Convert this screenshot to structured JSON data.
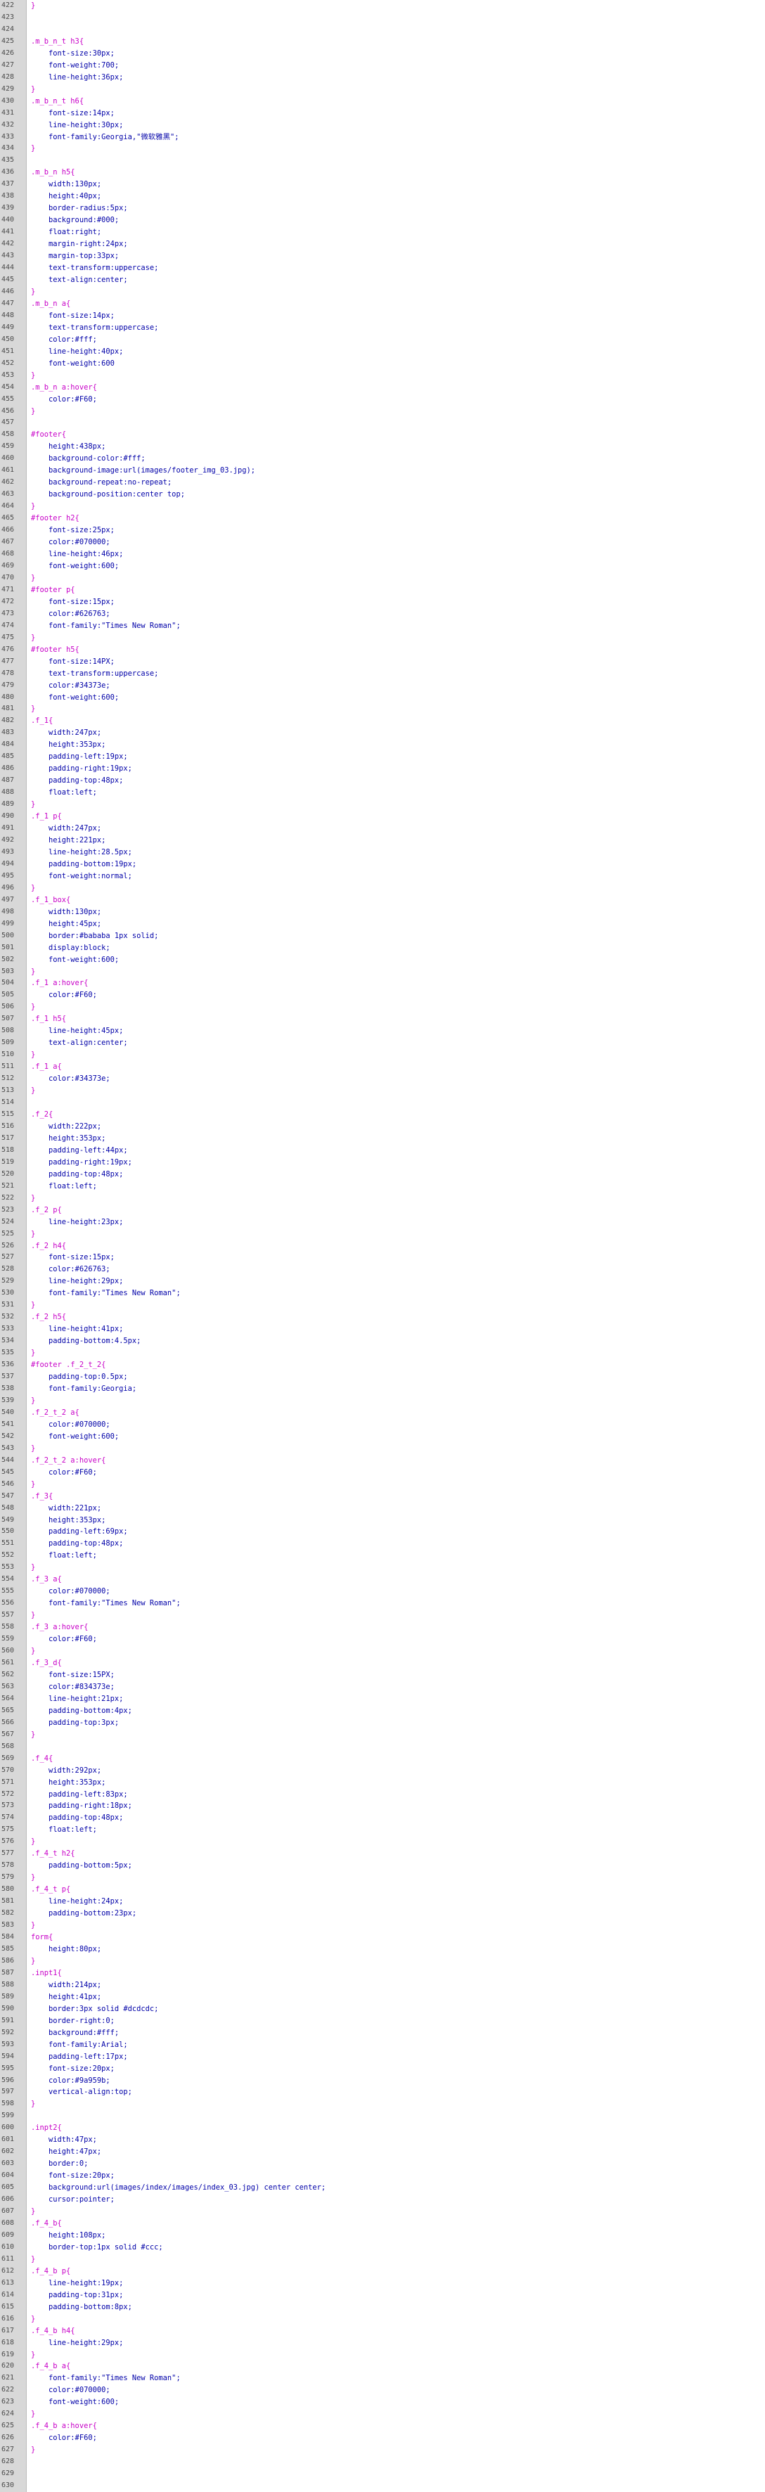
{
  "editor": {
    "colors": {
      "selector": "#c800c8",
      "brace": "#c800c8",
      "property": "#0000a8",
      "value": "#0000a8",
      "gutter_bg": "#d8d8d8",
      "line_number": "#4a4a4a"
    },
    "lines": [
      {
        "n": "422",
        "code": "}",
        "kind": "brace"
      },
      {
        "n": "423",
        "code": "",
        "kind": "blank"
      },
      {
        "n": "424",
        "code": "",
        "kind": "blank"
      },
      {
        "n": "425",
        "code": ".m_b_n_t h3{",
        "kind": "sel"
      },
      {
        "n": "426",
        "code": "    font-size:30px;",
        "kind": "decl"
      },
      {
        "n": "427",
        "code": "    font-weight:700;",
        "kind": "decl"
      },
      {
        "n": "428",
        "code": "    line-height:36px;",
        "kind": "decl"
      },
      {
        "n": "429",
        "code": "}",
        "kind": "brace"
      },
      {
        "n": "430",
        "code": ".m_b_n_t h6{",
        "kind": "sel"
      },
      {
        "n": "431",
        "code": "    font-size:14px;",
        "kind": "decl"
      },
      {
        "n": "432",
        "code": "    line-height:30px;",
        "kind": "decl"
      },
      {
        "n": "433",
        "code": "    font-family:Georgia,\"微软雅黑\";",
        "kind": "decl"
      },
      {
        "n": "434",
        "code": "}",
        "kind": "brace"
      },
      {
        "n": "435",
        "code": "",
        "kind": "blank"
      },
      {
        "n": "436",
        "code": ".m_b_n h5{",
        "kind": "sel"
      },
      {
        "n": "437",
        "code": "    width:130px;",
        "kind": "decl"
      },
      {
        "n": "438",
        "code": "    height:40px;",
        "kind": "decl"
      },
      {
        "n": "439",
        "code": "    border-radius:5px;",
        "kind": "decl"
      },
      {
        "n": "440",
        "code": "    background:#000;",
        "kind": "decl"
      },
      {
        "n": "441",
        "code": "    float:right;",
        "kind": "decl"
      },
      {
        "n": "442",
        "code": "    margin-right:24px;",
        "kind": "decl"
      },
      {
        "n": "443",
        "code": "    margin-top:33px;",
        "kind": "decl"
      },
      {
        "n": "444",
        "code": "    text-transform:uppercase;",
        "kind": "decl"
      },
      {
        "n": "445",
        "code": "    text-align:center;",
        "kind": "decl"
      },
      {
        "n": "446",
        "code": "}",
        "kind": "brace"
      },
      {
        "n": "447",
        "code": ".m_b_n a{",
        "kind": "sel"
      },
      {
        "n": "448",
        "code": "    font-size:14px;",
        "kind": "decl"
      },
      {
        "n": "449",
        "code": "    text-transform:uppercase;",
        "kind": "decl"
      },
      {
        "n": "450",
        "code": "    color:#fff;",
        "kind": "decl"
      },
      {
        "n": "451",
        "code": "    line-height:40px;",
        "kind": "decl"
      },
      {
        "n": "452",
        "code": "    font-weight:600",
        "kind": "decl"
      },
      {
        "n": "453",
        "code": "}",
        "kind": "brace"
      },
      {
        "n": "454",
        "code": ".m_b_n a:hover{",
        "kind": "sel"
      },
      {
        "n": "455",
        "code": "    color:#F60;",
        "kind": "decl"
      },
      {
        "n": "456",
        "code": "}",
        "kind": "brace"
      },
      {
        "n": "457",
        "code": "",
        "kind": "blank"
      },
      {
        "n": "458",
        "code": "#footer{",
        "kind": "sel"
      },
      {
        "n": "459",
        "code": "    height:438px;",
        "kind": "decl"
      },
      {
        "n": "460",
        "code": "    background-color:#fff;",
        "kind": "decl"
      },
      {
        "n": "461",
        "code": "    background-image:url(images/footer_img_03.jpg);",
        "kind": "decl"
      },
      {
        "n": "462",
        "code": "    background-repeat:no-repeat;",
        "kind": "decl"
      },
      {
        "n": "463",
        "code": "    background-position:center top;",
        "kind": "decl"
      },
      {
        "n": "464",
        "code": "}",
        "kind": "brace"
      },
      {
        "n": "465",
        "code": "#footer h2{",
        "kind": "sel"
      },
      {
        "n": "466",
        "code": "    font-size:25px;",
        "kind": "decl"
      },
      {
        "n": "467",
        "code": "    color:#070000;",
        "kind": "decl"
      },
      {
        "n": "468",
        "code": "    line-height:46px;",
        "kind": "decl"
      },
      {
        "n": "469",
        "code": "    font-weight:600;",
        "kind": "decl"
      },
      {
        "n": "470",
        "code": "}",
        "kind": "brace"
      },
      {
        "n": "471",
        "code": "#footer p{",
        "kind": "sel"
      },
      {
        "n": "472",
        "code": "    font-size:15px;",
        "kind": "decl"
      },
      {
        "n": "473",
        "code": "    color:#626763;",
        "kind": "decl"
      },
      {
        "n": "474",
        "code": "    font-family:\"Times New Roman\";",
        "kind": "decl"
      },
      {
        "n": "475",
        "code": "}",
        "kind": "brace"
      },
      {
        "n": "476",
        "code": "#footer h5{",
        "kind": "sel"
      },
      {
        "n": "477",
        "code": "    font-size:14PX;",
        "kind": "decl"
      },
      {
        "n": "478",
        "code": "    text-transform:uppercase;",
        "kind": "decl"
      },
      {
        "n": "479",
        "code": "    color:#34373e;",
        "kind": "decl"
      },
      {
        "n": "480",
        "code": "    font-weight:600;",
        "kind": "decl"
      },
      {
        "n": "481",
        "code": "}",
        "kind": "brace"
      },
      {
        "n": "482",
        "code": ".f_1{",
        "kind": "sel"
      },
      {
        "n": "483",
        "code": "    width:247px;",
        "kind": "decl"
      },
      {
        "n": "484",
        "code": "    height:353px;",
        "kind": "decl"
      },
      {
        "n": "485",
        "code": "    padding-left:19px;",
        "kind": "decl"
      },
      {
        "n": "486",
        "code": "    padding-right:19px;",
        "kind": "decl"
      },
      {
        "n": "487",
        "code": "    padding-top:48px;",
        "kind": "decl"
      },
      {
        "n": "488",
        "code": "    float:left;",
        "kind": "decl"
      },
      {
        "n": "489",
        "code": "}",
        "kind": "brace"
      },
      {
        "n": "490",
        "code": ".f_1 p{",
        "kind": "sel"
      },
      {
        "n": "491",
        "code": "    width:247px;",
        "kind": "decl"
      },
      {
        "n": "492",
        "code": "    height:221px;",
        "kind": "decl"
      },
      {
        "n": "493",
        "code": "    line-height:28.5px;",
        "kind": "decl"
      },
      {
        "n": "494",
        "code": "    padding-bottom:19px;",
        "kind": "decl"
      },
      {
        "n": "495",
        "code": "    font-weight:normal;",
        "kind": "decl"
      },
      {
        "n": "496",
        "code": "}",
        "kind": "brace"
      },
      {
        "n": "497",
        "code": ".f_1_box{",
        "kind": "sel"
      },
      {
        "n": "498",
        "code": "    width:130px;",
        "kind": "decl"
      },
      {
        "n": "499",
        "code": "    height:45px;",
        "kind": "decl"
      },
      {
        "n": "500",
        "code": "    border:#bababa 1px solid;",
        "kind": "decl"
      },
      {
        "n": "501",
        "code": "    display:block;",
        "kind": "decl"
      },
      {
        "n": "502",
        "code": "    font-weight:600;",
        "kind": "decl"
      },
      {
        "n": "503",
        "code": "}",
        "kind": "brace"
      },
      {
        "n": "504",
        "code": ".f_1 a:hover{",
        "kind": "sel"
      },
      {
        "n": "505",
        "code": "    color:#F60;",
        "kind": "decl"
      },
      {
        "n": "506",
        "code": "}",
        "kind": "brace"
      },
      {
        "n": "507",
        "code": ".f_1 h5{",
        "kind": "sel"
      },
      {
        "n": "508",
        "code": "    line-height:45px;",
        "kind": "decl"
      },
      {
        "n": "509",
        "code": "    text-align:center;",
        "kind": "decl"
      },
      {
        "n": "510",
        "code": "}",
        "kind": "brace"
      },
      {
        "n": "511",
        "code": ".f_1 a{",
        "kind": "sel"
      },
      {
        "n": "512",
        "code": "    color:#34373e;",
        "kind": "decl"
      },
      {
        "n": "513",
        "code": "}",
        "kind": "brace"
      },
      {
        "n": "514",
        "code": "",
        "kind": "blank"
      },
      {
        "n": "515",
        "code": ".f_2{",
        "kind": "sel"
      },
      {
        "n": "516",
        "code": "    width:222px;",
        "kind": "decl"
      },
      {
        "n": "517",
        "code": "    height:353px;",
        "kind": "decl"
      },
      {
        "n": "518",
        "code": "    padding-left:44px;",
        "kind": "decl"
      },
      {
        "n": "519",
        "code": "    padding-right:19px;",
        "kind": "decl"
      },
      {
        "n": "520",
        "code": "    padding-top:48px;",
        "kind": "decl"
      },
      {
        "n": "521",
        "code": "    float:left;",
        "kind": "decl"
      },
      {
        "n": "522",
        "code": "}",
        "kind": "brace"
      },
      {
        "n": "523",
        "code": ".f_2 p{",
        "kind": "sel"
      },
      {
        "n": "524",
        "code": "    line-height:23px;",
        "kind": "decl"
      },
      {
        "n": "525",
        "code": "}",
        "kind": "brace"
      },
      {
        "n": "526",
        "code": ".f_2 h4{",
        "kind": "sel"
      },
      {
        "n": "527",
        "code": "    font-size:15px;",
        "kind": "decl"
      },
      {
        "n": "528",
        "code": "    color:#626763;",
        "kind": "decl"
      },
      {
        "n": "529",
        "code": "    line-height:29px;",
        "kind": "decl"
      },
      {
        "n": "530",
        "code": "    font-family:\"Times New Roman\";",
        "kind": "decl"
      },
      {
        "n": "531",
        "code": "}",
        "kind": "brace"
      },
      {
        "n": "532",
        "code": ".f_2 h5{",
        "kind": "sel"
      },
      {
        "n": "533",
        "code": "    line-height:41px;",
        "kind": "decl"
      },
      {
        "n": "534",
        "code": "    padding-bottom:4.5px;",
        "kind": "decl"
      },
      {
        "n": "535",
        "code": "}",
        "kind": "brace"
      },
      {
        "n": "536",
        "code": "#footer .f_2_t_2{",
        "kind": "sel"
      },
      {
        "n": "537",
        "code": "    padding-top:0.5px;",
        "kind": "decl"
      },
      {
        "n": "538",
        "code": "    font-family:Georgia;",
        "kind": "decl"
      },
      {
        "n": "539",
        "code": "}",
        "kind": "brace"
      },
      {
        "n": "540",
        "code": ".f_2_t_2 a{",
        "kind": "sel"
      },
      {
        "n": "541",
        "code": "    color:#070000;",
        "kind": "decl"
      },
      {
        "n": "542",
        "code": "    font-weight:600;",
        "kind": "decl"
      },
      {
        "n": "543",
        "code": "}",
        "kind": "brace"
      },
      {
        "n": "544",
        "code": ".f_2_t_2 a:hover{",
        "kind": "sel"
      },
      {
        "n": "545",
        "code": "    color:#F60;",
        "kind": "decl"
      },
      {
        "n": "546",
        "code": "}",
        "kind": "brace"
      },
      {
        "n": "547",
        "code": ".f_3{",
        "kind": "sel"
      },
      {
        "n": "548",
        "code": "    width:221px;",
        "kind": "decl"
      },
      {
        "n": "549",
        "code": "    height:353px;",
        "kind": "decl"
      },
      {
        "n": "550",
        "code": "    padding-left:69px;",
        "kind": "decl"
      },
      {
        "n": "551",
        "code": "    padding-top:48px;",
        "kind": "decl"
      },
      {
        "n": "552",
        "code": "    float:left;",
        "kind": "decl"
      },
      {
        "n": "553",
        "code": "}",
        "kind": "brace"
      },
      {
        "n": "554",
        "code": ".f_3 a{",
        "kind": "sel"
      },
      {
        "n": "555",
        "code": "    color:#070000;",
        "kind": "decl"
      },
      {
        "n": "556",
        "code": "    font-family:\"Times New Roman\";",
        "kind": "decl"
      },
      {
        "n": "557",
        "code": "}",
        "kind": "brace"
      },
      {
        "n": "558",
        "code": ".f_3 a:hover{",
        "kind": "sel"
      },
      {
        "n": "559",
        "code": "    color:#F60;",
        "kind": "decl"
      },
      {
        "n": "560",
        "code": "}",
        "kind": "brace"
      },
      {
        "n": "561",
        "code": ".f_3_d{",
        "kind": "sel"
      },
      {
        "n": "562",
        "code": "    font-size:15PX;",
        "kind": "decl"
      },
      {
        "n": "563",
        "code": "    color:#834373e;",
        "kind": "decl"
      },
      {
        "n": "564",
        "code": "    line-height:21px;",
        "kind": "decl"
      },
      {
        "n": "565",
        "code": "    padding-bottom:4px;",
        "kind": "decl"
      },
      {
        "n": "566",
        "code": "    padding-top:3px;",
        "kind": "decl"
      },
      {
        "n": "567",
        "code": "}",
        "kind": "brace"
      },
      {
        "n": "568",
        "code": "",
        "kind": "blank"
      },
      {
        "n": "569",
        "code": ".f_4{",
        "kind": "sel"
      },
      {
        "n": "570",
        "code": "    width:292px;",
        "kind": "decl"
      },
      {
        "n": "571",
        "code": "    height:353px;",
        "kind": "decl"
      },
      {
        "n": "572",
        "code": "    padding-left:83px;",
        "kind": "decl"
      },
      {
        "n": "573",
        "code": "    padding-right:18px;",
        "kind": "decl"
      },
      {
        "n": "574",
        "code": "    padding-top:48px;",
        "kind": "decl"
      },
      {
        "n": "575",
        "code": "    float:left;",
        "kind": "decl"
      },
      {
        "n": "576",
        "code": "}",
        "kind": "brace"
      },
      {
        "n": "577",
        "code": ".f_4_t h2{",
        "kind": "sel"
      },
      {
        "n": "578",
        "code": "    padding-bottom:5px;",
        "kind": "decl"
      },
      {
        "n": "579",
        "code": "}",
        "kind": "brace"
      },
      {
        "n": "580",
        "code": ".f_4_t p{",
        "kind": "sel"
      },
      {
        "n": "581",
        "code": "    line-height:24px;",
        "kind": "decl"
      },
      {
        "n": "582",
        "code": "    padding-bottom:23px;",
        "kind": "decl"
      },
      {
        "n": "583",
        "code": "}",
        "kind": "brace"
      },
      {
        "n": "584",
        "code": "form{",
        "kind": "sel"
      },
      {
        "n": "585",
        "code": "    height:80px;",
        "kind": "decl"
      },
      {
        "n": "586",
        "code": "}",
        "kind": "brace"
      },
      {
        "n": "587",
        "code": ".inpt1{",
        "kind": "sel"
      },
      {
        "n": "588",
        "code": "    width:214px;",
        "kind": "decl"
      },
      {
        "n": "589",
        "code": "    height:41px;",
        "kind": "decl"
      },
      {
        "n": "590",
        "code": "    border:3px solid #dcdcdc;",
        "kind": "decl"
      },
      {
        "n": "591",
        "code": "    border-right:0;",
        "kind": "decl"
      },
      {
        "n": "592",
        "code": "    background:#fff;",
        "kind": "decl"
      },
      {
        "n": "593",
        "code": "    font-family:Arial;",
        "kind": "decl"
      },
      {
        "n": "594",
        "code": "    padding-left:17px;",
        "kind": "decl"
      },
      {
        "n": "595",
        "code": "    font-size:20px;",
        "kind": "decl"
      },
      {
        "n": "596",
        "code": "    color:#9a959b;",
        "kind": "decl"
      },
      {
        "n": "597",
        "code": "    vertical-align:top;",
        "kind": "decl"
      },
      {
        "n": "598",
        "code": "}",
        "kind": "brace"
      },
      {
        "n": "599",
        "code": "",
        "kind": "blank"
      },
      {
        "n": "600",
        "code": ".inpt2{",
        "kind": "sel"
      },
      {
        "n": "601",
        "code": "    width:47px;",
        "kind": "decl"
      },
      {
        "n": "602",
        "code": "    height:47px;",
        "kind": "decl"
      },
      {
        "n": "603",
        "code": "    border:0;",
        "kind": "decl"
      },
      {
        "n": "604",
        "code": "    font-size:20px;",
        "kind": "decl"
      },
      {
        "n": "605",
        "code": "    background:url(images/index/images/index_03.jpg) center center;",
        "kind": "decl"
      },
      {
        "n": "606",
        "code": "    cursor:pointer;",
        "kind": "decl"
      },
      {
        "n": "607",
        "code": "}",
        "kind": "brace"
      },
      {
        "n": "608",
        "code": ".f_4_b{",
        "kind": "sel"
      },
      {
        "n": "609",
        "code": "    height:108px;",
        "kind": "decl"
      },
      {
        "n": "610",
        "code": "    border-top:1px solid #ccc;",
        "kind": "decl"
      },
      {
        "n": "611",
        "code": "}",
        "kind": "brace"
      },
      {
        "n": "612",
        "code": ".f_4_b p{",
        "kind": "sel"
      },
      {
        "n": "613",
        "code": "    line-height:19px;",
        "kind": "decl"
      },
      {
        "n": "614",
        "code": "    padding-top:31px;",
        "kind": "decl"
      },
      {
        "n": "615",
        "code": "    padding-bottom:8px;",
        "kind": "decl"
      },
      {
        "n": "616",
        "code": "}",
        "kind": "brace"
      },
      {
        "n": "617",
        "code": ".f_4_b h4{",
        "kind": "sel"
      },
      {
        "n": "618",
        "code": "    line-height:29px;",
        "kind": "decl"
      },
      {
        "n": "619",
        "code": "}",
        "kind": "brace"
      },
      {
        "n": "620",
        "code": ".f_4_b a{",
        "kind": "sel"
      },
      {
        "n": "621",
        "code": "    font-family:\"Times New Roman\";",
        "kind": "decl"
      },
      {
        "n": "622",
        "code": "    color:#070000;",
        "kind": "decl"
      },
      {
        "n": "623",
        "code": "    font-weight:600;",
        "kind": "decl"
      },
      {
        "n": "624",
        "code": "}",
        "kind": "brace"
      },
      {
        "n": "625",
        "code": ".f_4_b a:hover{",
        "kind": "sel"
      },
      {
        "n": "626",
        "code": "    color:#F60;",
        "kind": "decl"
      },
      {
        "n": "627",
        "code": "}",
        "kind": "brace"
      },
      {
        "n": "628",
        "code": "",
        "kind": "blank"
      },
      {
        "n": "629",
        "code": "",
        "kind": "blank"
      },
      {
        "n": "630",
        "code": "",
        "kind": "blank"
      }
    ]
  }
}
